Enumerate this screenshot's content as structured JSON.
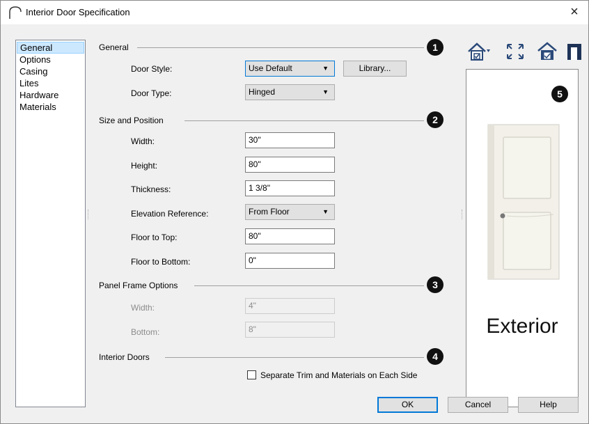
{
  "window": {
    "title": "Interior Door Specification",
    "close_glyph": "×"
  },
  "nav": {
    "items": [
      "General",
      "Options",
      "Casing",
      "Lites",
      "Hardware",
      "Materials"
    ],
    "selected": "General"
  },
  "general": {
    "label": "General",
    "badge": "1",
    "door_style_label": "Door Style:",
    "door_style_value": "Use Default",
    "library_button": "Library...",
    "door_type_label": "Door Type:",
    "door_type_value": "Hinged"
  },
  "size_position": {
    "label": "Size and Position",
    "badge": "2",
    "width_label": "Width:",
    "width_value": "30\"",
    "height_label": "Height:",
    "height_value": "80\"",
    "thickness_label": "Thickness:",
    "thickness_value": "1 3/8\"",
    "elev_ref_label": "Elevation Reference:",
    "elev_ref_value": "From Floor",
    "floor_top_label": "Floor to Top:",
    "floor_top_value": "80\"",
    "floor_bottom_label": "Floor to Bottom:",
    "floor_bottom_value": "0\""
  },
  "panel_frame": {
    "label": "Panel Frame Options",
    "badge": "3",
    "width_label": "Width:",
    "width_value": "4\"",
    "bottom_label": "Bottom:",
    "bottom_value": "8\""
  },
  "interior_doors": {
    "label": "Interior Doors",
    "badge": "4",
    "separate_label": "Separate Trim and Materials on Each Side",
    "separate_checked": false
  },
  "preview": {
    "badge": "5",
    "caption": "Exterior"
  },
  "toolbar": {
    "icons": [
      "view-type-icon",
      "fit-view-icon",
      "door-preview-icon",
      "frame-icon"
    ]
  },
  "footer": {
    "ok": "OK",
    "cancel": "Cancel",
    "help": "Help"
  },
  "colors": {
    "accent": "#0078d7",
    "selection_bg": "#cce8ff",
    "dialog_bg": "#f0f0f0"
  }
}
